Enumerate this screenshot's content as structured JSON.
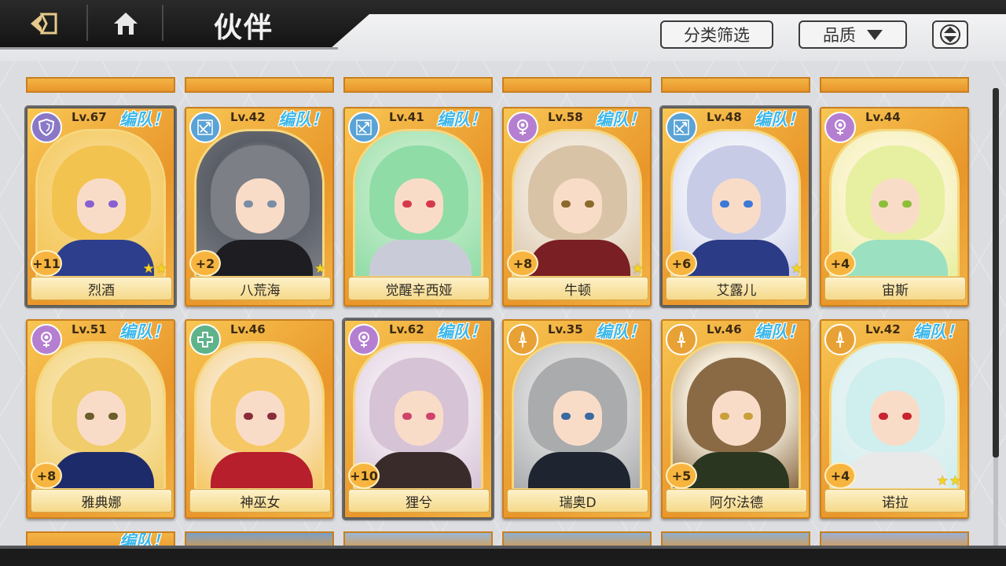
{
  "header": {
    "title": "伙伴",
    "filter_label": "分类筛选",
    "quality_label": "品质"
  },
  "colors": {
    "card_gold": "#e9962a",
    "team_text": "#3db8ea",
    "role_shield": "#8a78c7",
    "role_bow": "#5aa3d6",
    "role_staff": "#b57fd1",
    "role_heal": "#5fb38b",
    "role_sword": "#e7a135"
  },
  "row1": [
    {
      "name": "烈酒",
      "level": "Lv.67",
      "team": "编队！",
      "plus": "+11",
      "stars": 2,
      "role": "shield-icon"
    },
    {
      "name": "八荒海",
      "level": "Lv.42",
      "team": "编队！",
      "plus": "+2",
      "stars": 1,
      "role": "bow-icon"
    },
    {
      "name": "觉醒辛西娅",
      "level": "Lv.41",
      "team": "编队！",
      "plus": "",
      "stars": 0,
      "role": "bow-icon"
    },
    {
      "name": "牛顿",
      "level": "Lv.58",
      "team": "编队！",
      "plus": "+8",
      "stars": 1,
      "role": "staff-icon"
    },
    {
      "name": "艾露儿",
      "level": "Lv.48",
      "team": "编队！",
      "plus": "+6",
      "stars": 1,
      "role": "bow-icon"
    },
    {
      "name": "宙斯",
      "level": "Lv.44",
      "team": "",
      "plus": "+4",
      "stars": 0,
      "role": "staff-icon"
    }
  ],
  "row2": [
    {
      "name": "雅典娜",
      "level": "Lv.51",
      "team": "编队！",
      "plus": "+8",
      "stars": 0,
      "role": "staff-icon"
    },
    {
      "name": "神巫女",
      "level": "Lv.46",
      "team": "",
      "plus": "",
      "stars": 0,
      "role": "heal-icon"
    },
    {
      "name": "狸兮",
      "level": "Lv.62",
      "team": "编队！",
      "plus": "+10",
      "stars": 0,
      "role": "staff-icon"
    },
    {
      "name": "瑞奥D",
      "level": "Lv.35",
      "team": "编队！",
      "plus": "",
      "stars": 0,
      "role": "sword-icon"
    },
    {
      "name": "阿尔法德",
      "level": "Lv.46",
      "team": "编队！",
      "plus": "+5",
      "stars": 0,
      "role": "sword-icon"
    },
    {
      "name": "诺拉",
      "level": "Lv.42",
      "team": "编队！",
      "plus": "+4",
      "stars": 2,
      "role": "sword-icon"
    }
  ],
  "row3_partial": [
    {
      "team": "编队！"
    }
  ]
}
